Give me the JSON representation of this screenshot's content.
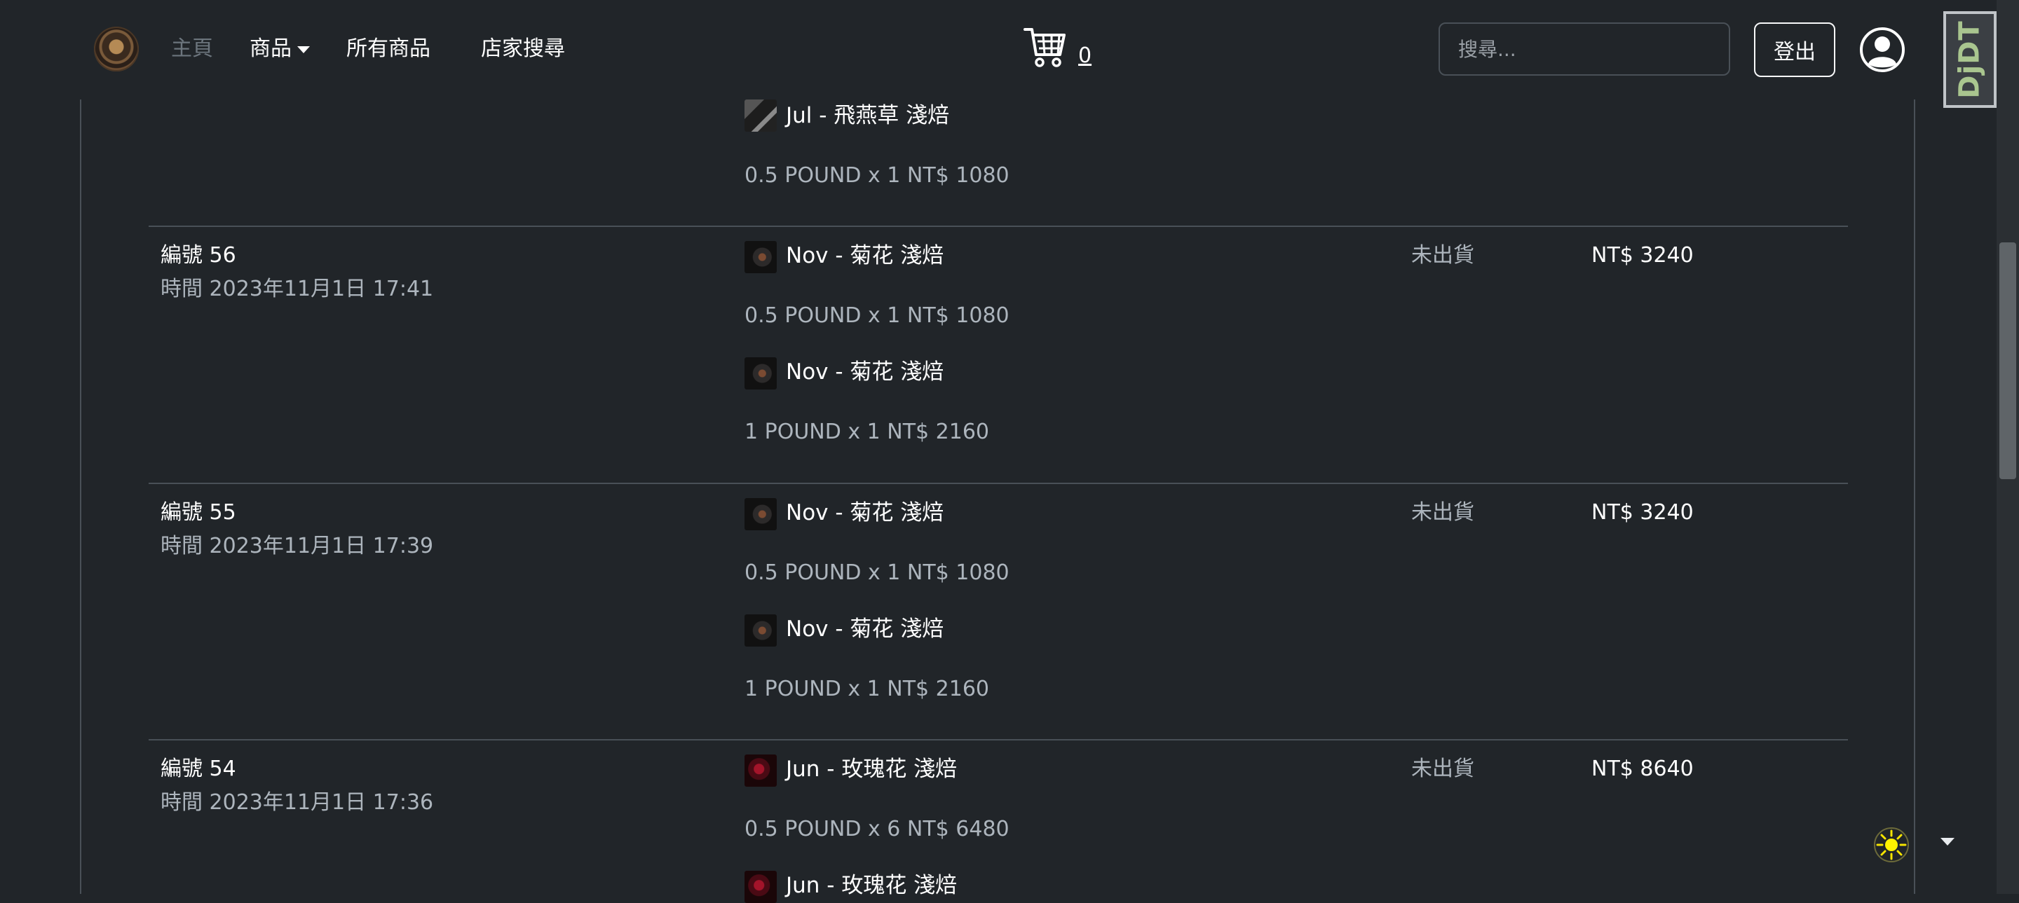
{
  "nav": {
    "home": "主頁",
    "products": "商品",
    "all_products": "所有商品",
    "store_search": "店家搜尋",
    "cart_count": "0",
    "search_placeholder": "搜尋...",
    "logout": "登出",
    "debug_toolbar": "DjDT"
  },
  "partial_item": {
    "name": "Jul - 飛燕草 淺焙",
    "detail": "0.5 POUND x 1 NT$ 1080"
  },
  "orders": [
    {
      "number": "編號 56",
      "time": "時間 2023年11月1日 17:41",
      "status": "未出貨",
      "total": "NT$ 3240",
      "items": [
        {
          "name": "Nov - 菊花 淺焙",
          "detail": "0.5 POUND x 1 NT$ 1080"
        },
        {
          "name": "Nov - 菊花 淺焙",
          "detail": "1 POUND x 1 NT$ 2160"
        }
      ]
    },
    {
      "number": "編號 55",
      "time": "時間 2023年11月1日 17:39",
      "status": "未出貨",
      "total": "NT$ 3240",
      "items": [
        {
          "name": "Nov - 菊花 淺焙",
          "detail": "0.5 POUND x 1 NT$ 1080"
        },
        {
          "name": "Nov - 菊花 淺焙",
          "detail": "1 POUND x 1 NT$ 2160"
        }
      ]
    },
    {
      "number": "編號 54",
      "time": "時間 2023年11月1日 17:36",
      "status": "未出貨",
      "total": "NT$ 8640",
      "items": [
        {
          "name": "Jun - 玫瑰花 淺焙",
          "detail": "0.5 POUND x 6 NT$ 6480"
        },
        {
          "name": "Jun - 玫瑰花 淺焙",
          "detail": ""
        }
      ]
    }
  ]
}
